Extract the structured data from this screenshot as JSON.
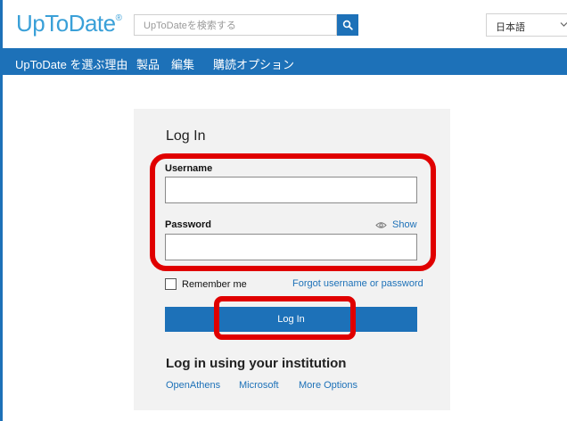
{
  "header": {
    "logo_text": "UpToDate",
    "logo_mark": "®",
    "search_placeholder": "UpToDateを検索する",
    "search_icon": "search-icon",
    "language": "日本語"
  },
  "nav": {
    "items": [
      "UpToDate を選ぶ理由",
      "製品",
      "編集",
      "購読オプション"
    ]
  },
  "login": {
    "title": "Log In",
    "username_label": "Username",
    "username_value": "",
    "password_label": "Password",
    "password_value": "",
    "show_label": "Show",
    "remember_label": "Remember me",
    "forgot_link": "Forgot username or password",
    "submit_label": "Log In"
  },
  "institution": {
    "title": "Log in using your institution",
    "links": [
      "OpenAthens",
      "Microsoft",
      "More Options"
    ]
  },
  "colors": {
    "brand_blue": "#1d71b8",
    "logo_blue": "#3aa0d8",
    "highlight_red": "#e00000"
  }
}
